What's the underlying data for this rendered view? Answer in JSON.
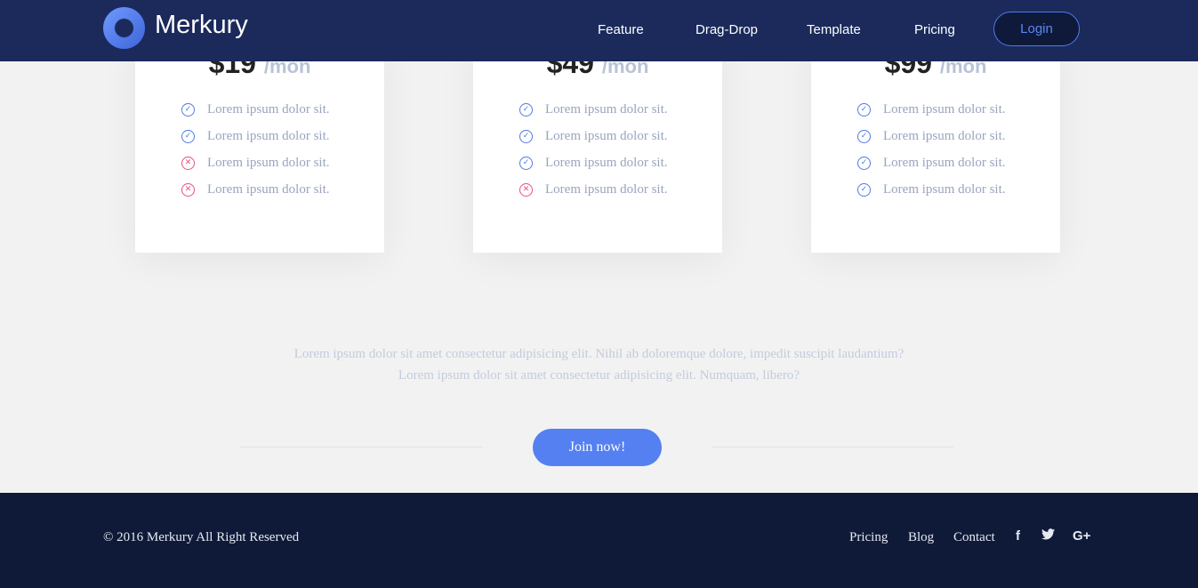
{
  "brand": {
    "name": "Merkury"
  },
  "nav": {
    "items": [
      "Feature",
      "Drag-Drop",
      "Template",
      "Pricing"
    ],
    "login_label": "Login"
  },
  "pricing": {
    "plans": [
      {
        "price": "$19",
        "period": "/mon",
        "features": [
          {
            "text": "Lorem ipsum dolor sit.",
            "included": true
          },
          {
            "text": "Lorem ipsum dolor sit.",
            "included": true
          },
          {
            "text": "Lorem ipsum dolor sit.",
            "included": false
          },
          {
            "text": "Lorem ipsum dolor sit.",
            "included": false
          }
        ]
      },
      {
        "price": "$49",
        "period": "/mon",
        "features": [
          {
            "text": "Lorem ipsum dolor sit.",
            "included": true
          },
          {
            "text": "Lorem ipsum dolor sit.",
            "included": true
          },
          {
            "text": "Lorem ipsum dolor sit.",
            "included": true
          },
          {
            "text": "Lorem ipsum dolor sit.",
            "included": false
          }
        ]
      },
      {
        "price": "$99",
        "period": "/mon",
        "features": [
          {
            "text": "Lorem ipsum dolor sit.",
            "included": true
          },
          {
            "text": "Lorem ipsum dolor sit.",
            "included": true
          },
          {
            "text": "Lorem ipsum dolor sit.",
            "included": true
          },
          {
            "text": "Lorem ipsum dolor sit.",
            "included": true
          }
        ]
      }
    ]
  },
  "about": {
    "line1": "Lorem ipsum dolor sit amet consectetur adipisicing elit. Nihil ab doloremque dolore, impedit suscipit laudantium?",
    "line2": "Lorem ipsum dolor sit amet consectetur adipisicing elit. Numquam, libero?"
  },
  "cta": {
    "join_label": "Join now!"
  },
  "footer": {
    "copyright": "© 2016 Merkury All Right Reserved",
    "links": [
      "Pricing",
      "Blog",
      "Contact"
    ],
    "social": [
      "facebook-icon",
      "twitter-icon",
      "google-plus-icon"
    ]
  },
  "colors": {
    "header_bg": "#1b2a5b",
    "accent": "#5580f2",
    "check": "#4f79e6",
    "cross": "#ec4f7a",
    "footer_bg": "#0f1a38"
  }
}
